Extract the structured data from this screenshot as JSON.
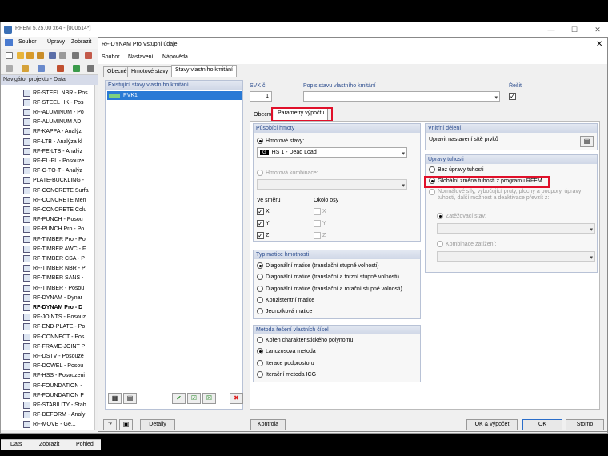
{
  "main": {
    "title": "RFEM 5.25.00 x64 - [000614*]",
    "menu": [
      "Soubor",
      "Úpravy",
      "Zobrazit"
    ],
    "navigator_header": "Navigátor projektu - Data",
    "tree": [
      "RF-STEEL NBR - Pos",
      "RF-STEEL HK - Pos",
      "RF-ALUMINUM - Po",
      "RF-ALUMINUM AD",
      "RF-KAPPA - Analýz",
      "RF-LTB - Analýza kl",
      "RF-FE-LTB - Analýz",
      "RF-EL-PL - Posouze",
      "RF-C-TO-T - Analýz",
      "PLATE-BUCKLING -",
      "RF-CONCRETE Surfa",
      "RF-CONCRETE Men",
      "RF-CONCRETE Colu",
      "RF-PUNCH - Posou",
      "RF-PUNCH Pro - Po",
      "RF-TIMBER Pro - Po",
      "RF-TIMBER AWC - F",
      "RF-TIMBER CSA - P",
      "RF-TIMBER NBR - P",
      "RF-TIMBER SANS -",
      "RF-TIMBER - Posou",
      "RF-DYNAM - Dynar",
      "RF-DYNAM Pro - D",
      "RF-JOINTS - Posouz",
      "RF-END-PLATE - Po",
      "RF-CONNECT - Pos",
      "RF-FRAME-JOINT P",
      "RF-DSTV - Posouze",
      "RF-DOWEL - Posou",
      "RF-HSS - Posouzeni",
      "RF-FOUNDATION -",
      "RF-FOUNDATION P",
      "RF-STABILITY - Stab",
      "RF-DEFORM - Analy",
      "RF-MOVE - Ge..."
    ],
    "nav_tabs": [
      "Dats",
      "Zobrazit",
      "Pohled"
    ]
  },
  "dialog": {
    "title": "RF-DYNAM Pro Vstupní údaje",
    "menu": [
      "Soubor",
      "Nastavení",
      "Nápověda"
    ],
    "tabs": [
      "Obecné",
      "Hmotové stavy",
      "Stavy vlastního kmitání"
    ],
    "left_header": "Existující stavy vlastního kmitání",
    "list_item": "PVK1",
    "svk_label": "SVK č.",
    "svk_value": "1",
    "popis_label": "Popis stavu vlastního kmitání",
    "resit_label": "Řešit",
    "inner_tabs": [
      "Obecné",
      "Parametry výpočtu"
    ],
    "pusobici": {
      "header": "Působící hmoty",
      "hmotove_stavy": "Hmotové stavy:",
      "hs_badge": "G",
      "hs_value": "HS 1 - Dead Load",
      "hmotova_kombinace": "Hmotová kombinace:",
      "ve_smeru": "Ve směru",
      "okolo_osy": "Okolo osy",
      "axes": [
        "X",
        "Y",
        "Z"
      ]
    },
    "typ_matice": {
      "header": "Typ matice hmotnosti",
      "options": [
        "Diagonální matice (translační stupně volnosti)",
        "Diagonální matice (translační a torzní stupně volnosti)",
        "Diagonální matice (translační a rotační stupně volnosti)",
        "Konzistentní matice",
        "Jednotková matice"
      ]
    },
    "metoda": {
      "header": "Metoda řešení vlastních čísel",
      "options": [
        "Kořen charakteristického polynomu",
        "Lanczosova metoda",
        "Iterace podprostoru",
        "Iterační metoda ICG"
      ]
    },
    "vnitrni": {
      "header": "Vnitřní dělení",
      "text": "Upravit nastavení sítě prvků"
    },
    "upravy": {
      "header": "Úpravy tuhosti",
      "opt1": "Bez úpravy tuhosti",
      "opt2": "Globální změna tuhosti z programu RFEM",
      "opt3_line1": "Normálové síly, vybočující pruty, plochy a podpory, úpravy",
      "opt3_line2": "tuhosti, další možnost a deaktivace převzít z:",
      "zatezovaci": "Zatěžovací stav:",
      "kombinace": "Kombinace zatížení:"
    },
    "buttons": {
      "detaily": "Detaily",
      "kontrola": "Kontrola",
      "ok_vypocet": "OK & výpočet",
      "ok": "OK",
      "storno": "Storno"
    }
  }
}
